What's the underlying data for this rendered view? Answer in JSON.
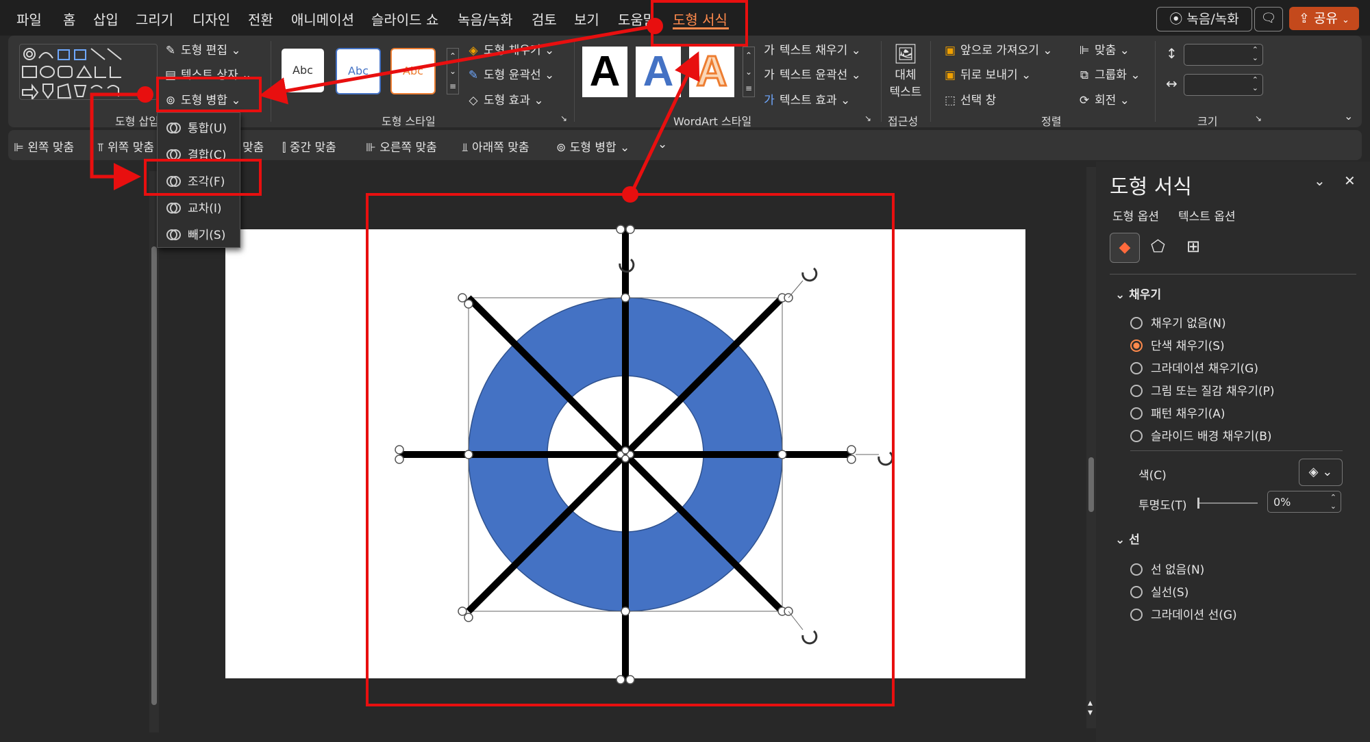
{
  "menu": {
    "items": [
      "파일",
      "홈",
      "삽입",
      "그리기",
      "디자인",
      "전환",
      "애니메이션",
      "슬라이드 쇼",
      "녹음/녹화",
      "검토",
      "보기",
      "도움말"
    ],
    "active": "도형 서식",
    "record": "녹음/녹화",
    "share": "공유"
  },
  "ribbon": {
    "insert_shapes": {
      "edit_shape": "도형 편집",
      "text_box": "텍스트 상자",
      "merge_shapes": "도형 병합",
      "label": "도형 삽입"
    },
    "shape_styles": {
      "thumb": "Abc",
      "fill": "도형 채우기",
      "outline": "도형 윤곽선",
      "effects": "도형 효과",
      "label": "도형 스타일"
    },
    "wordart": {
      "letter": "A",
      "text_fill": "텍스트 채우기",
      "text_outline": "텍스트 윤곽선",
      "text_effects": "텍스트 효과",
      "label": "WordArt 스타일"
    },
    "accessibility": {
      "alt_text_1": "대체",
      "alt_text_2": "텍스트",
      "label": "접근성"
    },
    "arrange": {
      "bring_forward": "앞으로 가져오기",
      "send_backward": "뒤로 보내기",
      "selection_pane": "선택 창",
      "align": "맞춤",
      "group": "그룹화",
      "rotate": "회전",
      "label": "정렬"
    },
    "size": {
      "label": "크기"
    }
  },
  "quick_access": {
    "items": [
      "왼쪽 맞춤",
      "위쪽 맞춤",
      "맞춤",
      "중간 맞춤",
      "오른쪽 맞춤",
      "아래쪽 맞춤",
      "도형 병합"
    ]
  },
  "merge_dropdown": {
    "items": [
      "통합(U)",
      "결합(C)",
      "조각(F)",
      "교차(I)",
      "빼기(S)"
    ]
  },
  "format_pane": {
    "title": "도형 서식",
    "tabs": [
      "도형 옵션",
      "텍스트 옵션"
    ],
    "fill": {
      "header": "채우기",
      "options": [
        "채우기 없음(N)",
        "단색 채우기(S)",
        "그라데이션 채우기(G)",
        "그림 또는 질감 채우기(P)",
        "패턴 채우기(A)",
        "슬라이드 배경 채우기(B)"
      ],
      "selected_index": 1,
      "color_label": "색(C)",
      "transparency_label": "투명도(T)",
      "transparency_value": "0%"
    },
    "line": {
      "header": "선",
      "options": [
        "선 없음(N)",
        "실선(S)",
        "그라데이션 선(G)"
      ]
    }
  },
  "colors": {
    "accent": "#ff8a4c",
    "donut": "#4472c4",
    "annotation": "#e80f0f"
  }
}
